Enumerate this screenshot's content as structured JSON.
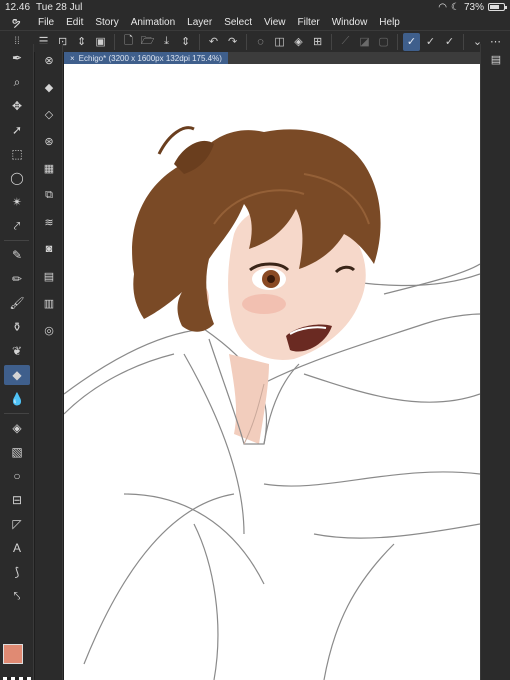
{
  "status": {
    "time": "12.46",
    "date": "Tue 28 Jul",
    "battery": "73%",
    "battery_level": 0.73
  },
  "menu": [
    "File",
    "Edit",
    "Story",
    "Animation",
    "Layer",
    "Select",
    "View",
    "Filter",
    "Window",
    "Help"
  ],
  "document": {
    "tab_label": "Echigo* (3200 x 1600px 132dpi 175.4%)"
  },
  "colors": {
    "main": "#e08a73",
    "accent": "#3f5f8c"
  },
  "tools": [
    "pen-nib-icon",
    "zoom-icon",
    "move-icon",
    "operation-icon",
    "selection-icon",
    "lasso-icon",
    "magic-wand-icon",
    "eyedropper-icon",
    "pen-icon",
    "pencil-icon",
    "brush-icon",
    "airbrush-icon",
    "decoration-icon",
    "eraser-icon",
    "blend-icon",
    "fill-icon",
    "gradient-icon",
    "figure-icon",
    "frame-icon",
    "ruler-icon",
    "text-icon",
    "balloon-icon",
    "correct-line-icon"
  ]
}
